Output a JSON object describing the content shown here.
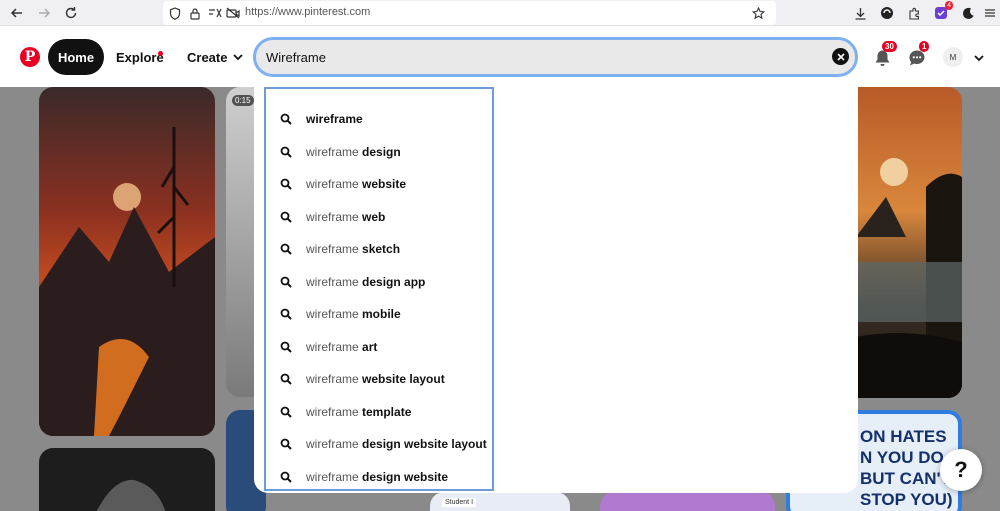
{
  "browser": {
    "url": "https://www.pinterest.com",
    "extension_badge": "4"
  },
  "header": {
    "logo": "P",
    "home_label": "Home",
    "explore_label": "Explore",
    "create_label": "Create",
    "search_value": "Wireframe",
    "notifications_count": "30",
    "messages_count": "1",
    "avatar_initial": "M"
  },
  "grid": {
    "video_duration": "0:15",
    "pin_text": [
      "ON HATES",
      "N YOU DO",
      "BUT CAN'T",
      "STOP YOU)"
    ],
    "student_label": "Student I"
  },
  "suggestions": [
    {
      "prefix": "",
      "suffix": "wireframe"
    },
    {
      "prefix": "wireframe ",
      "suffix": "design"
    },
    {
      "prefix": "wireframe ",
      "suffix": "website"
    },
    {
      "prefix": "wireframe ",
      "suffix": "web"
    },
    {
      "prefix": "wireframe ",
      "suffix": "sketch"
    },
    {
      "prefix": "wireframe ",
      "suffix": "design app"
    },
    {
      "prefix": "wireframe ",
      "suffix": "mobile"
    },
    {
      "prefix": "wireframe ",
      "suffix": "art"
    },
    {
      "prefix": "wireframe ",
      "suffix": "website layout"
    },
    {
      "prefix": "wireframe ",
      "suffix": "template"
    },
    {
      "prefix": "wireframe ",
      "suffix": "design website layout"
    },
    {
      "prefix": "wireframe ",
      "suffix": "design website"
    }
  ],
  "help_label": "?",
  "colors": {
    "brand": "#e60023",
    "search_focus": "#7fb0f0",
    "list_border": "#6f9bd8"
  }
}
